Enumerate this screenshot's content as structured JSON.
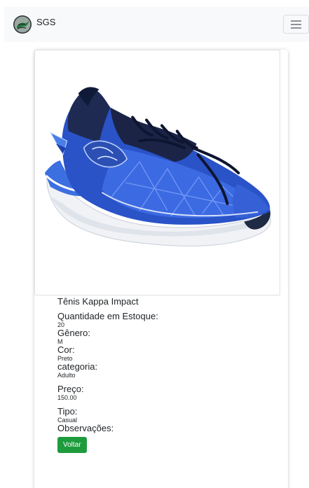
{
  "navbar": {
    "brand_text": "SGS",
    "brand_icon": "sgs-logo-icon",
    "toggler_icon": "hamburger-icon"
  },
  "product": {
    "name": "Tênis Kappa Impact",
    "image_icon": "sneaker-image",
    "stock_label": "Quantidade em Estoque:",
    "stock_value": "20",
    "gender_label": "Gênero:",
    "gender_value": "M",
    "color_label": "Cor:",
    "color_value": "Preto",
    "category_label": "categoria:",
    "category_value": "Adulto",
    "price_label": "Preço:",
    "price_value": "150.00",
    "type_label": "Tipo:",
    "type_value": "Casual",
    "notes_label": "Observações:"
  },
  "actions": {
    "back_label": "Voltar"
  },
  "colors": {
    "button_green": "#1e9c3c",
    "navbar_bg": "#f8f9fa",
    "shoe_blue": "#2a53c8"
  }
}
